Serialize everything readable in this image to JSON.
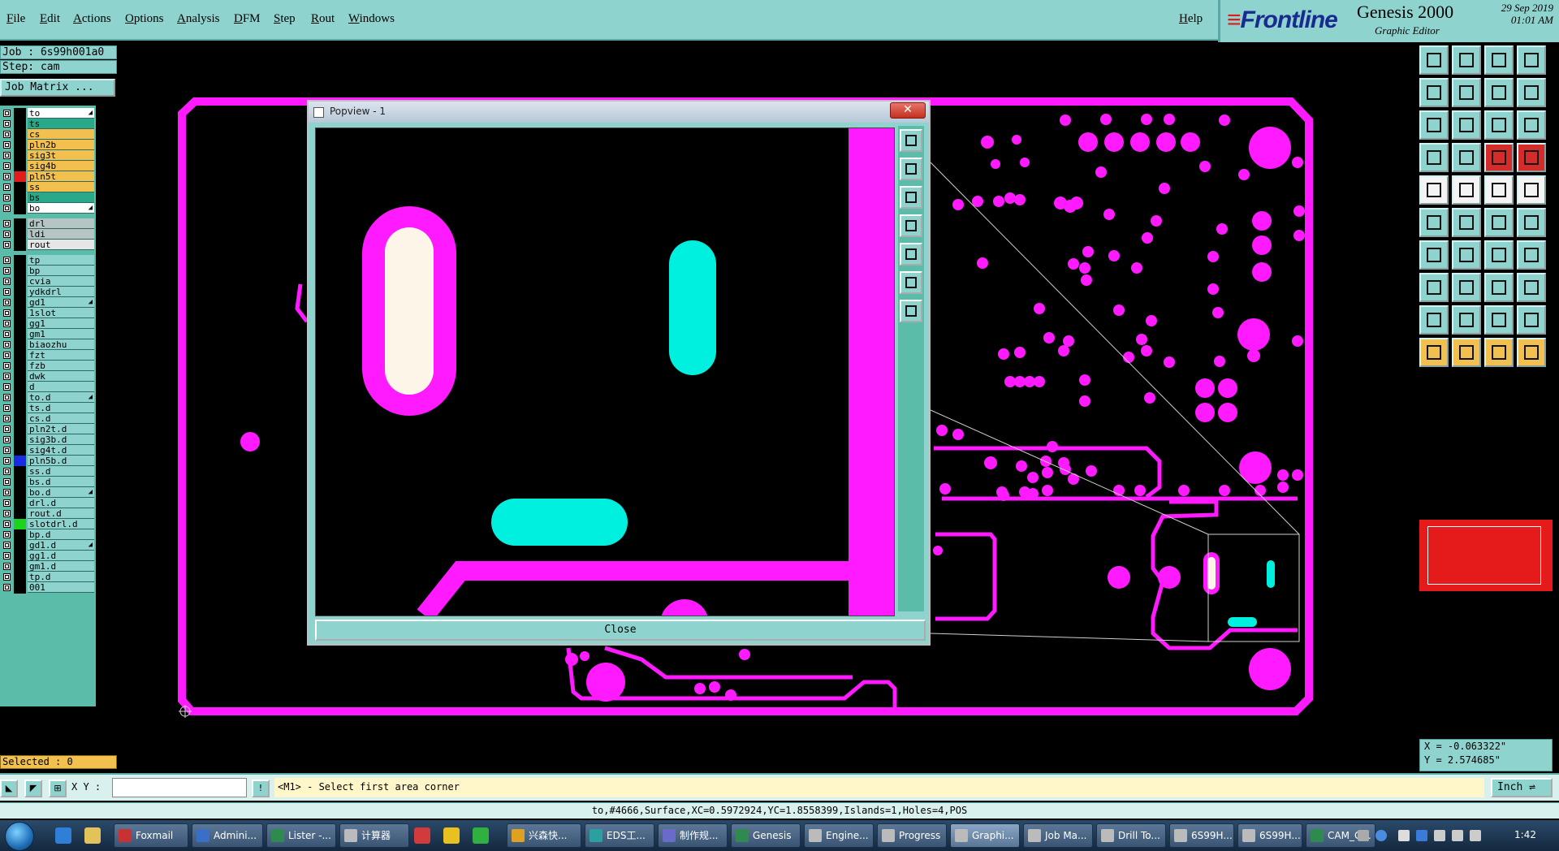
{
  "menu": {
    "items": [
      "File",
      "Edit",
      "Actions",
      "Options",
      "Analysis",
      "DFM",
      "Step",
      "Rout",
      "Windows"
    ],
    "help": "Help"
  },
  "brand": {
    "logo": "Frontline",
    "product": "Genesis 2000",
    "subtitle": "Graphic Editor",
    "date": "29 Sep 2019",
    "time": "01:01 AM"
  },
  "job": {
    "job_label": "Job : 6s99h001a0",
    "step_label": "Step: cam",
    "matrix_button": "Job Matrix ..."
  },
  "layers": [
    {
      "name": "to",
      "color": "#ffffff",
      "arrow": true
    },
    {
      "name": "ts",
      "color": "#2aa88a",
      "arrow": false
    },
    {
      "name": "cs",
      "color": "#f2c04f",
      "arrow": false
    },
    {
      "name": "pln2b",
      "color": "#f2c04f",
      "arrow": false
    },
    {
      "name": "sig3t",
      "color": "#f2c04f",
      "arrow": false
    },
    {
      "name": "sig4b",
      "color": "#f2c04f",
      "arrow": false
    },
    {
      "name": "pln5t",
      "color": "#f2c04f",
      "arrow": false,
      "swatch": "#e51b1b"
    },
    {
      "name": "ss",
      "color": "#f2c04f",
      "arrow": false
    },
    {
      "name": "bs",
      "color": "#2aa88a",
      "arrow": false
    },
    {
      "name": "bo",
      "color": "#ffffff",
      "arrow": true
    },
    {
      "name": "drl",
      "color": "#b6c4c4",
      "arrow": false
    },
    {
      "name": "ldi",
      "color": "#b6c4c4",
      "arrow": false
    },
    {
      "name": "rout",
      "color": "#e6e6e6",
      "arrow": false
    },
    {
      "name": "tp",
      "color": "#8fd3cf",
      "arrow": false
    },
    {
      "name": "bp",
      "color": "#8fd3cf",
      "arrow": false
    },
    {
      "name": "cvia",
      "color": "#8fd3cf",
      "arrow": false
    },
    {
      "name": "ydkdrl",
      "color": "#8fd3cf",
      "arrow": false
    },
    {
      "name": "gd1",
      "color": "#8fd3cf",
      "arrow": true
    },
    {
      "name": "1slot",
      "color": "#8fd3cf",
      "arrow": false
    },
    {
      "name": "gg1",
      "color": "#8fd3cf",
      "arrow": false
    },
    {
      "name": "gm1",
      "color": "#8fd3cf",
      "arrow": false
    },
    {
      "name": "biaozhu",
      "color": "#8fd3cf",
      "arrow": false
    },
    {
      "name": "fzt",
      "color": "#8fd3cf",
      "arrow": false
    },
    {
      "name": "fzb",
      "color": "#8fd3cf",
      "arrow": false
    },
    {
      "name": "dwk",
      "color": "#8fd3cf",
      "arrow": false
    },
    {
      "name": "d",
      "color": "#8fd3cf",
      "arrow": false
    },
    {
      "name": "to.d",
      "color": "#8fd3cf",
      "arrow": true
    },
    {
      "name": "ts.d",
      "color": "#8fd3cf",
      "arrow": false
    },
    {
      "name": "cs.d",
      "color": "#8fd3cf",
      "arrow": false
    },
    {
      "name": "pln2t.d",
      "color": "#8fd3cf",
      "arrow": false
    },
    {
      "name": "sig3b.d",
      "color": "#8fd3cf",
      "arrow": false
    },
    {
      "name": "sig4t.d",
      "color": "#8fd3cf",
      "arrow": false
    },
    {
      "name": "pln5b.d",
      "color": "#8fd3cf",
      "arrow": false,
      "swatch": "#1b2be5"
    },
    {
      "name": "ss.d",
      "color": "#8fd3cf",
      "arrow": false
    },
    {
      "name": "bs.d",
      "color": "#8fd3cf",
      "arrow": false
    },
    {
      "name": "bo.d",
      "color": "#8fd3cf",
      "arrow": true
    },
    {
      "name": "drl.d",
      "color": "#8fd3cf",
      "arrow": false
    },
    {
      "name": "rout.d",
      "color": "#8fd3cf",
      "arrow": false
    },
    {
      "name": "slotdrl.d",
      "color": "#8fd3cf",
      "arrow": false,
      "swatch": "#1bd41b"
    },
    {
      "name": "bp.d",
      "color": "#8fd3cf",
      "arrow": false
    },
    {
      "name": "gd1.d",
      "color": "#8fd3cf",
      "arrow": true
    },
    {
      "name": "gg1.d",
      "color": "#8fd3cf",
      "arrow": false
    },
    {
      "name": "gm1.d",
      "color": "#8fd3cf",
      "arrow": false
    },
    {
      "name": "tp.d",
      "color": "#8fd3cf",
      "arrow": false
    },
    {
      "name": "001",
      "color": "#8fd3cf",
      "arrow": false
    }
  ],
  "selected_label": "Selected : 0",
  "popview": {
    "title": "Popview - 1",
    "close_label": "Close"
  },
  "coords": {
    "x": "X = -0.063322\"",
    "y": "Y = 2.574685\""
  },
  "command": {
    "xy_label": "X Y :",
    "xy_value": "",
    "prompt": "<M1> - Select first area corner",
    "unit": "Inch"
  },
  "status": "to,#4666,Surface,XC=0.5972924,YC=1.8558399,Islands=1,Holes=4,POS",
  "taskbar": {
    "tasks": [
      "Foxmail",
      "Admini...",
      "Lister -...",
      "计算器",
      "兴森快...",
      "EDS工...",
      "制作规...",
      "Genesis",
      "Engine...",
      "Progress",
      "Graphi...",
      "Job Ma...",
      "Drill To...",
      "6S99H...",
      "6S99H...",
      "CAM_G..."
    ],
    "clock": "1:42"
  },
  "colors": {
    "magenta": "#ff1aff",
    "cyan": "#00f0e0",
    "cream": "#fdf6e8",
    "panel": "#8fd3cf"
  }
}
